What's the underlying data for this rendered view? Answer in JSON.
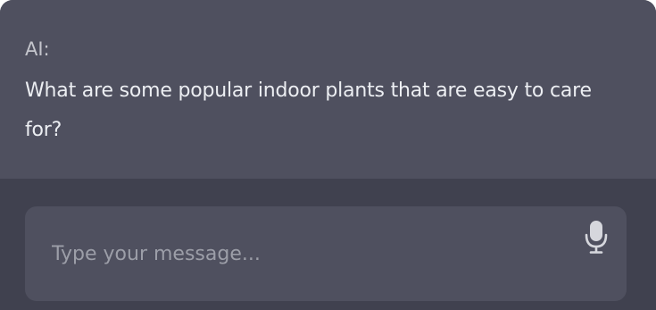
{
  "conversation": {
    "message": {
      "sender": "AI:",
      "text": "What are some popular indoor plants that are easy to care for?"
    }
  },
  "composer": {
    "placeholder": "Type your message...",
    "value": "",
    "mic_icon": "microphone-icon"
  },
  "colors": {
    "window_background": "#40414f",
    "message_background": "#4f505f",
    "input_background": "#4f505f",
    "text_primary": "#eceef2",
    "text_secondary": "#c4c5cc",
    "placeholder": "#9c9ea8"
  }
}
